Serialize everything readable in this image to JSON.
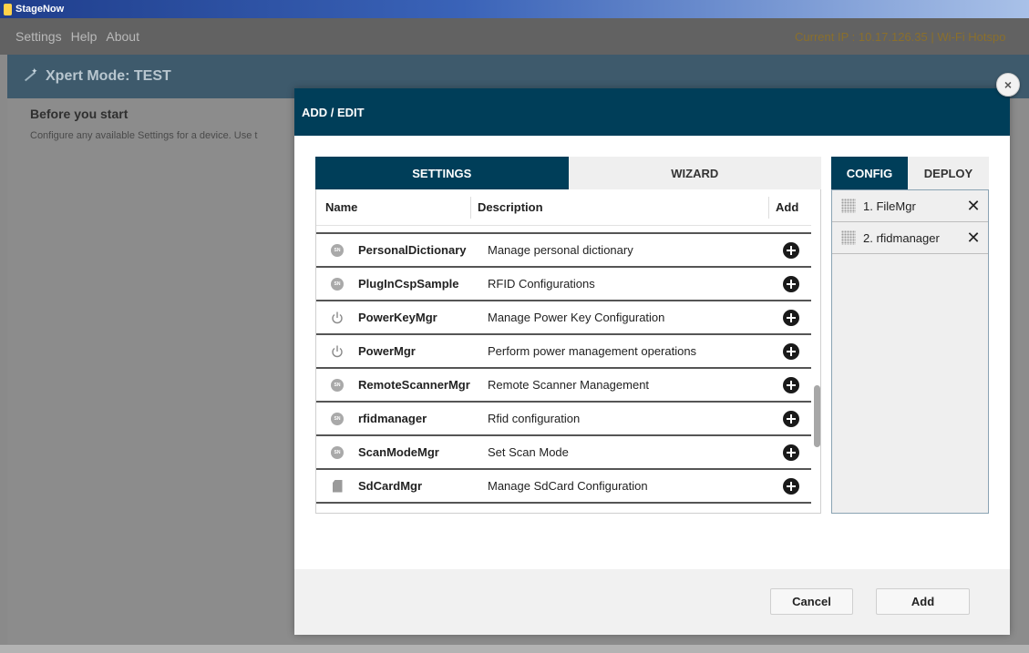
{
  "window": {
    "title": "StageNow"
  },
  "menu": {
    "items": [
      "Settings",
      "Help",
      "About"
    ],
    "ip_text": "Current IP :  10.17.126.35  |  Wi-Fi Hotspo"
  },
  "mode": {
    "title": "Xpert Mode: TEST"
  },
  "background": {
    "before_title": "Before you start",
    "before_desc": "Configure any available Settings for a device. Use t"
  },
  "dialog": {
    "title": "ADD / EDIT",
    "tabs": {
      "settings": "SETTINGS",
      "wizard": "WIZARD"
    },
    "table": {
      "headers": {
        "name": "Name",
        "description": "Description",
        "add": "Add"
      },
      "rows": [
        {
          "icon": "sn",
          "name": "PersonalDictionary",
          "description": "Manage personal dictionary"
        },
        {
          "icon": "sn",
          "name": "PlugInCspSample",
          "description": "RFID Configurations"
        },
        {
          "icon": "power",
          "name": "PowerKeyMgr",
          "description": "Manage Power Key Configuration"
        },
        {
          "icon": "power",
          "name": "PowerMgr",
          "description": "Perform power management operations"
        },
        {
          "icon": "sn",
          "name": "RemoteScannerMgr",
          "description": "Remote Scanner Management"
        },
        {
          "icon": "sn",
          "name": "rfidmanager",
          "description": "Rfid configuration"
        },
        {
          "icon": "sn",
          "name": "ScanModeMgr",
          "description": "Set Scan Mode"
        },
        {
          "icon": "sdcard",
          "name": "SdCardMgr",
          "description": "Manage SdCard Configuration"
        }
      ],
      "sn_badge": "SN"
    },
    "right_tabs": {
      "config": "CONFIG",
      "deploy": "DEPLOY"
    },
    "config_items": [
      "1. FileMgr",
      "2. rfidmanager"
    ],
    "buttons": {
      "cancel": "Cancel",
      "add": "Add"
    },
    "close_glyph": "×",
    "remove_glyph": "✕"
  }
}
